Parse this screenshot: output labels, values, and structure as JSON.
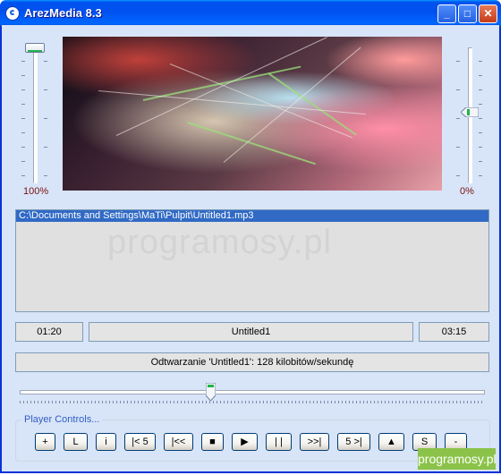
{
  "window": {
    "title": "ArezMedia 8.3",
    "minimize": "_",
    "maximize": "□",
    "close": "✕"
  },
  "volume_left": {
    "label": "100%",
    "value_percent": 100
  },
  "volume_right": {
    "label": "0%",
    "value_percent": 0
  },
  "playlist": {
    "items": [
      "C:\\Documents and Settings\\MaTi\\Pulpit\\Untitled1.mp3"
    ]
  },
  "watermark": "programosy.pl",
  "time": {
    "elapsed": "01:20",
    "track": "Untitled1",
    "total": "03:15"
  },
  "status": "Odtwarzanie 'Untitled1': 128 kilobitów/sekundę",
  "seek": {
    "position_fraction": 0.41
  },
  "controls": {
    "group_label": "Player Controls...",
    "buttons": [
      "+",
      "L",
      "i",
      "|< 5",
      "|<<",
      "■",
      "▶",
      "| |",
      ">>|",
      "5 >|",
      "▲",
      "S",
      "-"
    ]
  },
  "badge": "programosy.pl"
}
